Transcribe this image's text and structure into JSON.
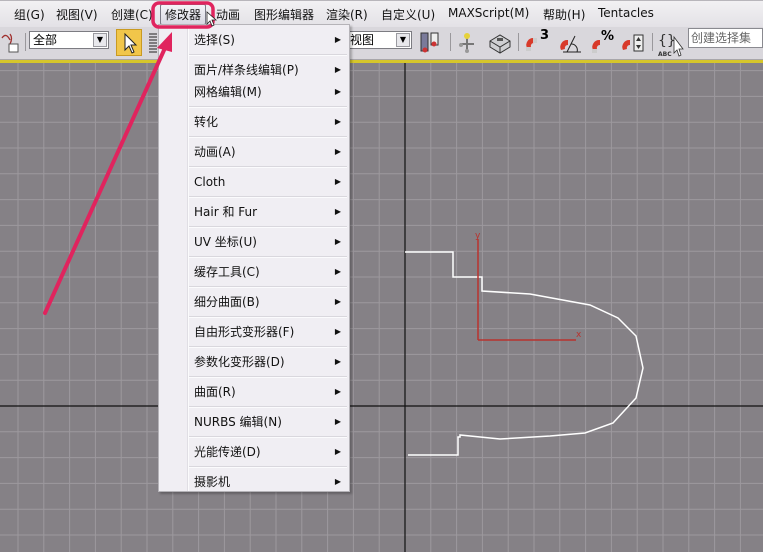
{
  "menubar": {
    "items": [
      {
        "label": "组(G)"
      },
      {
        "label": "视图(V)"
      },
      {
        "label": "创建(C)"
      },
      {
        "label": "修改器"
      },
      {
        "label": "动画"
      },
      {
        "label": "图形编辑器"
      },
      {
        "label": "渲染(R)"
      },
      {
        "label": "自定义(U)"
      },
      {
        "label": "MAXScript(M)"
      },
      {
        "label": "帮助(H)"
      },
      {
        "label": "Tentacles"
      }
    ],
    "active_index": 3
  },
  "toolbar": {
    "selection_filter": {
      "value": "全部"
    },
    "reference_coord": {
      "value": "视图"
    },
    "named_selection": {
      "placeholder": "创建选择集"
    },
    "icons": [
      "link-icon",
      "select-object-icon",
      "select-by-name-icon",
      "use-pivot-icon",
      "manipulate-icon",
      "keyboard-shortcut-icon",
      "snap-3d-icon",
      "angle-snap-icon",
      "percent-snap-icon",
      "spinner-snap-icon",
      "edit-named-selection-icon"
    ],
    "snap_label": "3",
    "percent_label": "%"
  },
  "dropdown_menu": {
    "items": [
      {
        "label": "选择(S)",
        "submenu": true
      },
      {
        "label": "面片/样条线编辑(P)",
        "submenu": true
      },
      {
        "label": "网格编辑(M)",
        "submenu": true
      },
      {
        "label": "转化",
        "submenu": true
      },
      {
        "label": "动画(A)",
        "submenu": true
      },
      {
        "label": "Cloth",
        "submenu": true
      },
      {
        "label": "Hair 和 Fur",
        "submenu": true
      },
      {
        "label": "UV 坐标(U)",
        "submenu": true
      },
      {
        "label": "缓存工具(C)",
        "submenu": true
      },
      {
        "label": "细分曲面(B)",
        "submenu": true
      },
      {
        "label": "自由形式变形器(F)",
        "submenu": true
      },
      {
        "label": "参数化变形器(D)",
        "submenu": true
      },
      {
        "label": "曲面(R)",
        "submenu": true
      },
      {
        "label": "NURBS 编辑(N)",
        "submenu": true
      },
      {
        "label": "光能传递(D)",
        "submenu": true
      },
      {
        "label": "摄影机",
        "submenu": true
      }
    ]
  },
  "viewport": {
    "gizmo": {
      "x_label": "x",
      "y_label": "y"
    }
  },
  "colors": {
    "highlight": "#e0245e",
    "gizmo": "#b8322e",
    "shape": "#ffffff",
    "viewport_bg": "#858186",
    "active_viewport_border": "#d6c62a"
  }
}
